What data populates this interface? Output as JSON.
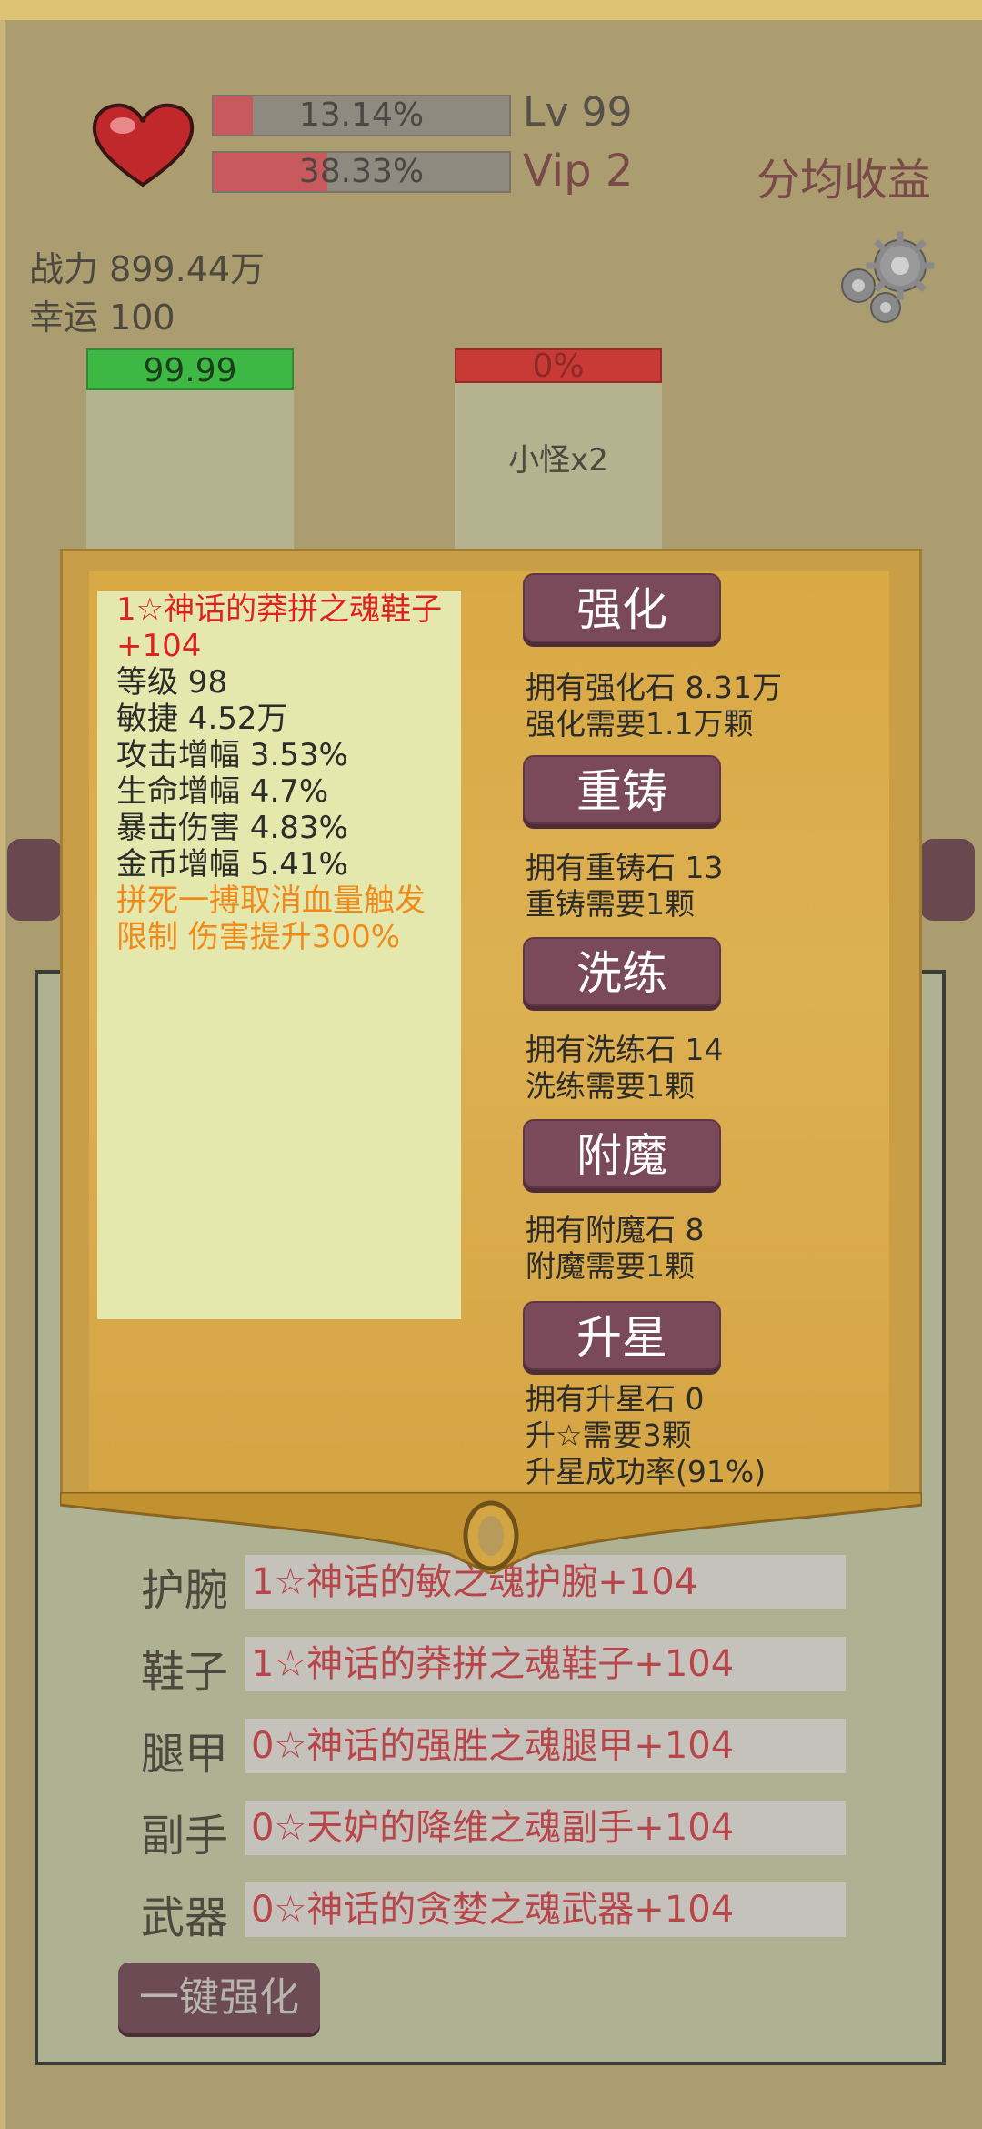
{
  "header": {
    "hp_bar": {
      "text": "13.14%",
      "fill_percent": 13.14
    },
    "exp_bar": {
      "text": "38.33%",
      "fill_percent": 38.33
    },
    "level": "Lv 99",
    "vip": "Vip 2",
    "share_label": "分均收益",
    "power": "战力 899.44万",
    "luck": "幸运 100"
  },
  "arena": {
    "player_hp": "99.99",
    "enemy_hp": "0%",
    "enemy_label": "小怪x2"
  },
  "item": {
    "title": "1☆神话的莽拼之魂鞋子+104",
    "stats": [
      "等级 98",
      "敏捷 4.52万",
      "攻击增幅 3.53%",
      "生命增幅 4.7%",
      "暴击伤害 4.83%",
      "金币增幅 5.41%"
    ],
    "special": "拼死一搏取消血量触发限制 伤害提升300%"
  },
  "actions": [
    {
      "label": "强化",
      "lines": [
        "拥有强化石 8.31万",
        "强化需要1.1万颗"
      ]
    },
    {
      "label": "重铸",
      "lines": [
        "拥有重铸石 13",
        "重铸需要1颗"
      ]
    },
    {
      "label": "洗练",
      "lines": [
        "拥有洗练石 14",
        "洗练需要1颗"
      ]
    },
    {
      "label": "附魔",
      "lines": [
        "拥有附魔石 8",
        "附魔需要1颗"
      ]
    },
    {
      "label": "升星",
      "lines": [
        "拥有升星石 0",
        "升☆需要3颗",
        "升星成功率(91%)"
      ]
    }
  ],
  "equipment": [
    {
      "slot": "护腕",
      "name": "1☆神话的敏之魂护腕+104"
    },
    {
      "slot": "鞋子",
      "name": "1☆神话的莽拼之魂鞋子+104"
    },
    {
      "slot": "腿甲",
      "name": "0☆神话的强胜之魂腿甲+104"
    },
    {
      "slot": "副手",
      "name": "0☆天妒的降维之魂副手+104"
    },
    {
      "slot": "武器",
      "name": "0☆神话的贪婪之魂武器+104"
    }
  ],
  "one_key_label": "一键强化",
  "colors": {
    "player_hp": "#3db845",
    "enemy_hp": "#c83a36",
    "button": "#7a4a5a",
    "item_title": "#e02020",
    "special": "#f08a1a"
  }
}
